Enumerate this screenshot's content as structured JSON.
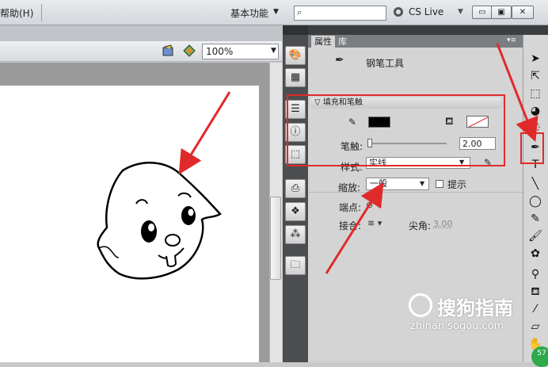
{
  "menubar": {
    "help_label": "帮助(H)",
    "workspace_label": "基本功能",
    "search_placeholder": "",
    "cslive_label": "CS Live"
  },
  "window_controls": {
    "minimize": "▭",
    "restore": "▣",
    "close": "✕"
  },
  "stage": {
    "zoom_value": "100%"
  },
  "panel": {
    "tab_properties": "属性",
    "tab_library": "库",
    "tool_name": "钢笔工具",
    "section_fill_stroke": "▽ 填充和笔触",
    "stroke_label": "笔触:",
    "stroke_value": "2.00",
    "style_label": "样式:",
    "style_value": "实线",
    "scale_label": "缩放:",
    "scale_value": "一般",
    "hint_label": "提示",
    "cap_label": "端点:",
    "join_label": "接合:",
    "miter_label": "尖角:",
    "miter_value": "3.00"
  },
  "colors": {
    "stroke_color": "#000000",
    "fill_color": "none",
    "annotation_red": "#e02a2a"
  },
  "watermark": {
    "text": "搜狗指南",
    "url": "zhinan.sogou.com"
  },
  "badge": "57"
}
